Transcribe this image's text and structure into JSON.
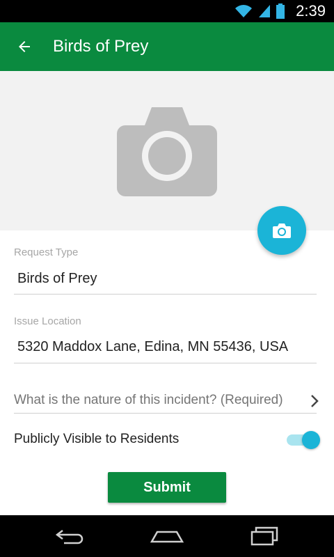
{
  "status_bar": {
    "time": "2:39",
    "icons": [
      "wifi-icon",
      "signal-icon",
      "battery-icon"
    ]
  },
  "app_bar": {
    "title": "Birds of Prey",
    "back_icon": "arrow-left-icon"
  },
  "photo": {
    "placeholder_icon": "camera-icon",
    "fab_icon": "camera-icon"
  },
  "form": {
    "request_type": {
      "label": "Request Type",
      "value": "Birds of Prey"
    },
    "issue_location": {
      "label": "Issue Location",
      "value": "5320 Maddox Lane, Edina, MN 55436, USA"
    },
    "nature": {
      "placeholder": "What is the nature of this incident? (Required)"
    },
    "public_toggle": {
      "label": "Publicly Visible to Residents",
      "on": true
    },
    "submit_label": "Submit"
  },
  "colors": {
    "primary_green": "#0a8a3f",
    "accent_cyan": "#1bb4d7"
  },
  "nav_bar": {
    "icons": [
      "back-nav-icon",
      "home-nav-icon",
      "recents-nav-icon"
    ]
  }
}
